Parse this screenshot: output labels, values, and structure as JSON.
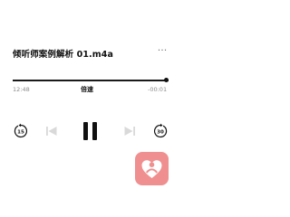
{
  "player": {
    "title": "倾听师案例解析 01.m4a",
    "more_label": "···",
    "elapsed": "12:48",
    "remaining": "-00:01",
    "speed_label": "倍速",
    "progress": 0.998,
    "skip_back_label": "15",
    "skip_forward_label": "30"
  },
  "icons": {
    "more": "more-dots-icon",
    "skip_back": "rewind-15-icon",
    "previous": "previous-track-icon",
    "play_pause": "pause-icon",
    "next": "next-track-icon",
    "skip_forward": "forward-30-icon",
    "favorite": "heart-app-icon"
  },
  "colors": {
    "accent": "#f08f8f",
    "text": "#111111",
    "muted": "#8a8a8a",
    "disabled": "#d9d9d9"
  }
}
